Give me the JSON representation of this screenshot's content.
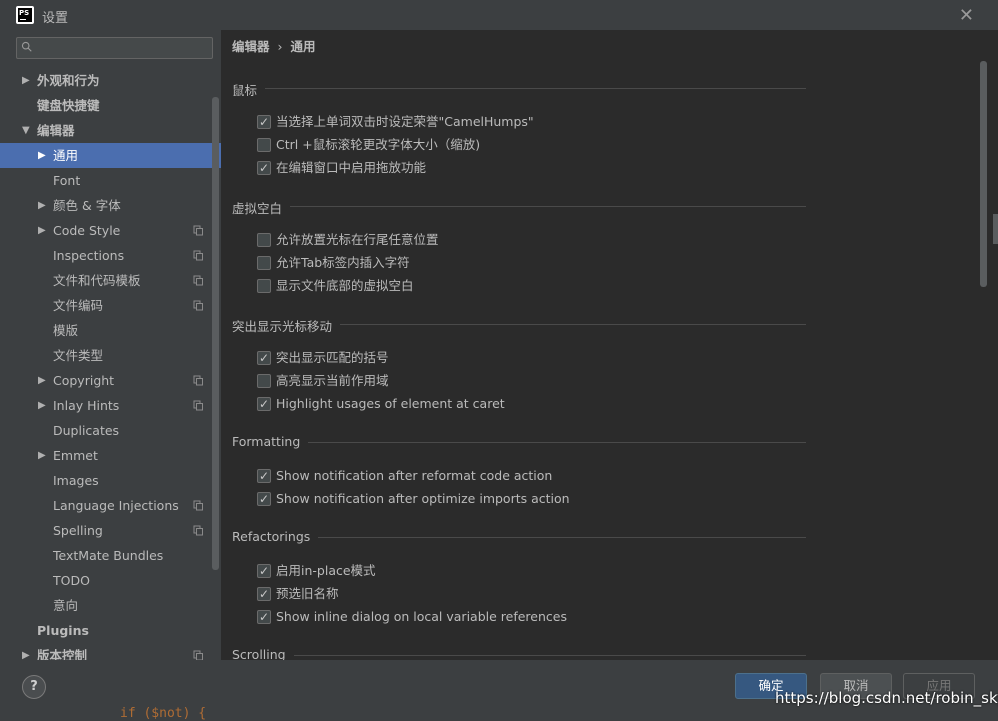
{
  "window": {
    "title": "设置",
    "app_icon_text": "PS"
  },
  "sidebar": {
    "search_placeholder": "",
    "items": [
      {
        "label": "外观和行为",
        "arrow": "▶",
        "level": 0,
        "bold": true,
        "copy": false
      },
      {
        "label": "键盘快捷键",
        "arrow": "",
        "level": 0,
        "bold": true,
        "copy": false
      },
      {
        "label": "编辑器",
        "arrow": "▼",
        "level": 0,
        "bold": true,
        "copy": false
      },
      {
        "label": "通用",
        "arrow": "▶",
        "level": 1,
        "bold": false,
        "copy": false,
        "selected": true
      },
      {
        "label": "Font",
        "arrow": "",
        "level": 1,
        "bold": false,
        "copy": false
      },
      {
        "label": "颜色 & 字体",
        "arrow": "▶",
        "level": 1,
        "bold": false,
        "copy": false
      },
      {
        "label": "Code Style",
        "arrow": "▶",
        "level": 1,
        "bold": false,
        "copy": true
      },
      {
        "label": "Inspections",
        "arrow": "",
        "level": 1,
        "bold": false,
        "copy": true
      },
      {
        "label": "文件和代码模板",
        "arrow": "",
        "level": 1,
        "bold": false,
        "copy": true
      },
      {
        "label": "文件编码",
        "arrow": "",
        "level": 1,
        "bold": false,
        "copy": true
      },
      {
        "label": "模版",
        "arrow": "",
        "level": 1,
        "bold": false,
        "copy": false
      },
      {
        "label": "文件类型",
        "arrow": "",
        "level": 1,
        "bold": false,
        "copy": false
      },
      {
        "label": "Copyright",
        "arrow": "▶",
        "level": 1,
        "bold": false,
        "copy": true
      },
      {
        "label": "Inlay Hints",
        "arrow": "▶",
        "level": 1,
        "bold": false,
        "copy": true
      },
      {
        "label": "Duplicates",
        "arrow": "",
        "level": 1,
        "bold": false,
        "copy": false
      },
      {
        "label": "Emmet",
        "arrow": "▶",
        "level": 1,
        "bold": false,
        "copy": false
      },
      {
        "label": "Images",
        "arrow": "",
        "level": 1,
        "bold": false,
        "copy": false
      },
      {
        "label": "Language Injections",
        "arrow": "",
        "level": 1,
        "bold": false,
        "copy": true
      },
      {
        "label": "Spelling",
        "arrow": "",
        "level": 1,
        "bold": false,
        "copy": true
      },
      {
        "label": "TextMate Bundles",
        "arrow": "",
        "level": 1,
        "bold": false,
        "copy": false
      },
      {
        "label": "TODO",
        "arrow": "",
        "level": 1,
        "bold": false,
        "copy": false
      },
      {
        "label": "意向",
        "arrow": "",
        "level": 1,
        "bold": false,
        "copy": false
      },
      {
        "label": "Plugins",
        "arrow": "",
        "level": 0,
        "bold": true,
        "copy": false
      },
      {
        "label": "版本控制",
        "arrow": "▶",
        "level": 0,
        "bold": true,
        "copy": true
      }
    ]
  },
  "breadcrumb": {
    "parent": "编辑器",
    "separator": "›",
    "current": "通用"
  },
  "sections": [
    {
      "title": "鼠标",
      "options": [
        {
          "label": "当选择上单词双击时设定荣誉\"CamelHumps\"",
          "checked": true
        },
        {
          "label": "Ctrl +鼠标滚轮更改字体大小（缩放)",
          "checked": false
        },
        {
          "label": "在编辑窗口中启用拖放功能",
          "checked": true
        }
      ]
    },
    {
      "title": "虚拟空白",
      "options": [
        {
          "label": "允许放置光标在行尾任意位置",
          "checked": false
        },
        {
          "label": "允许Tab标签内插入字符",
          "checked": false
        },
        {
          "label": "显示文件底部的虚拟空白",
          "checked": false
        }
      ]
    },
    {
      "title": "突出显示光标移动",
      "options": [
        {
          "label": "突出显示匹配的括号",
          "checked": true
        },
        {
          "label": "高亮显示当前作用域",
          "checked": false
        },
        {
          "label": "Highlight usages of element at caret",
          "checked": true
        }
      ]
    },
    {
      "title": "Formatting",
      "options": [
        {
          "label": "Show notification after reformat code action",
          "checked": true
        },
        {
          "label": "Show notification after optimize imports action",
          "checked": true
        }
      ]
    },
    {
      "title": "Refactorings",
      "options": [
        {
          "label": "启用in-place模式",
          "checked": true
        },
        {
          "label": "预选旧名称",
          "checked": true
        },
        {
          "label": "Show inline dialog on local variable references",
          "checked": true
        }
      ]
    },
    {
      "title": "Scrolling",
      "options": []
    }
  ],
  "footer": {
    "help_label": "?",
    "ok_label": "确定",
    "cancel_label": "取消",
    "apply_label": "应用",
    "watermark": "https://blog.csdn.net/robin_sky",
    "code_peek": "if ($not) {"
  },
  "colors": {
    "panel_bg": "#3c3f41",
    "content_bg": "#2b2b2b",
    "selection": "#4b6eaf",
    "primary_button": "#365880"
  }
}
